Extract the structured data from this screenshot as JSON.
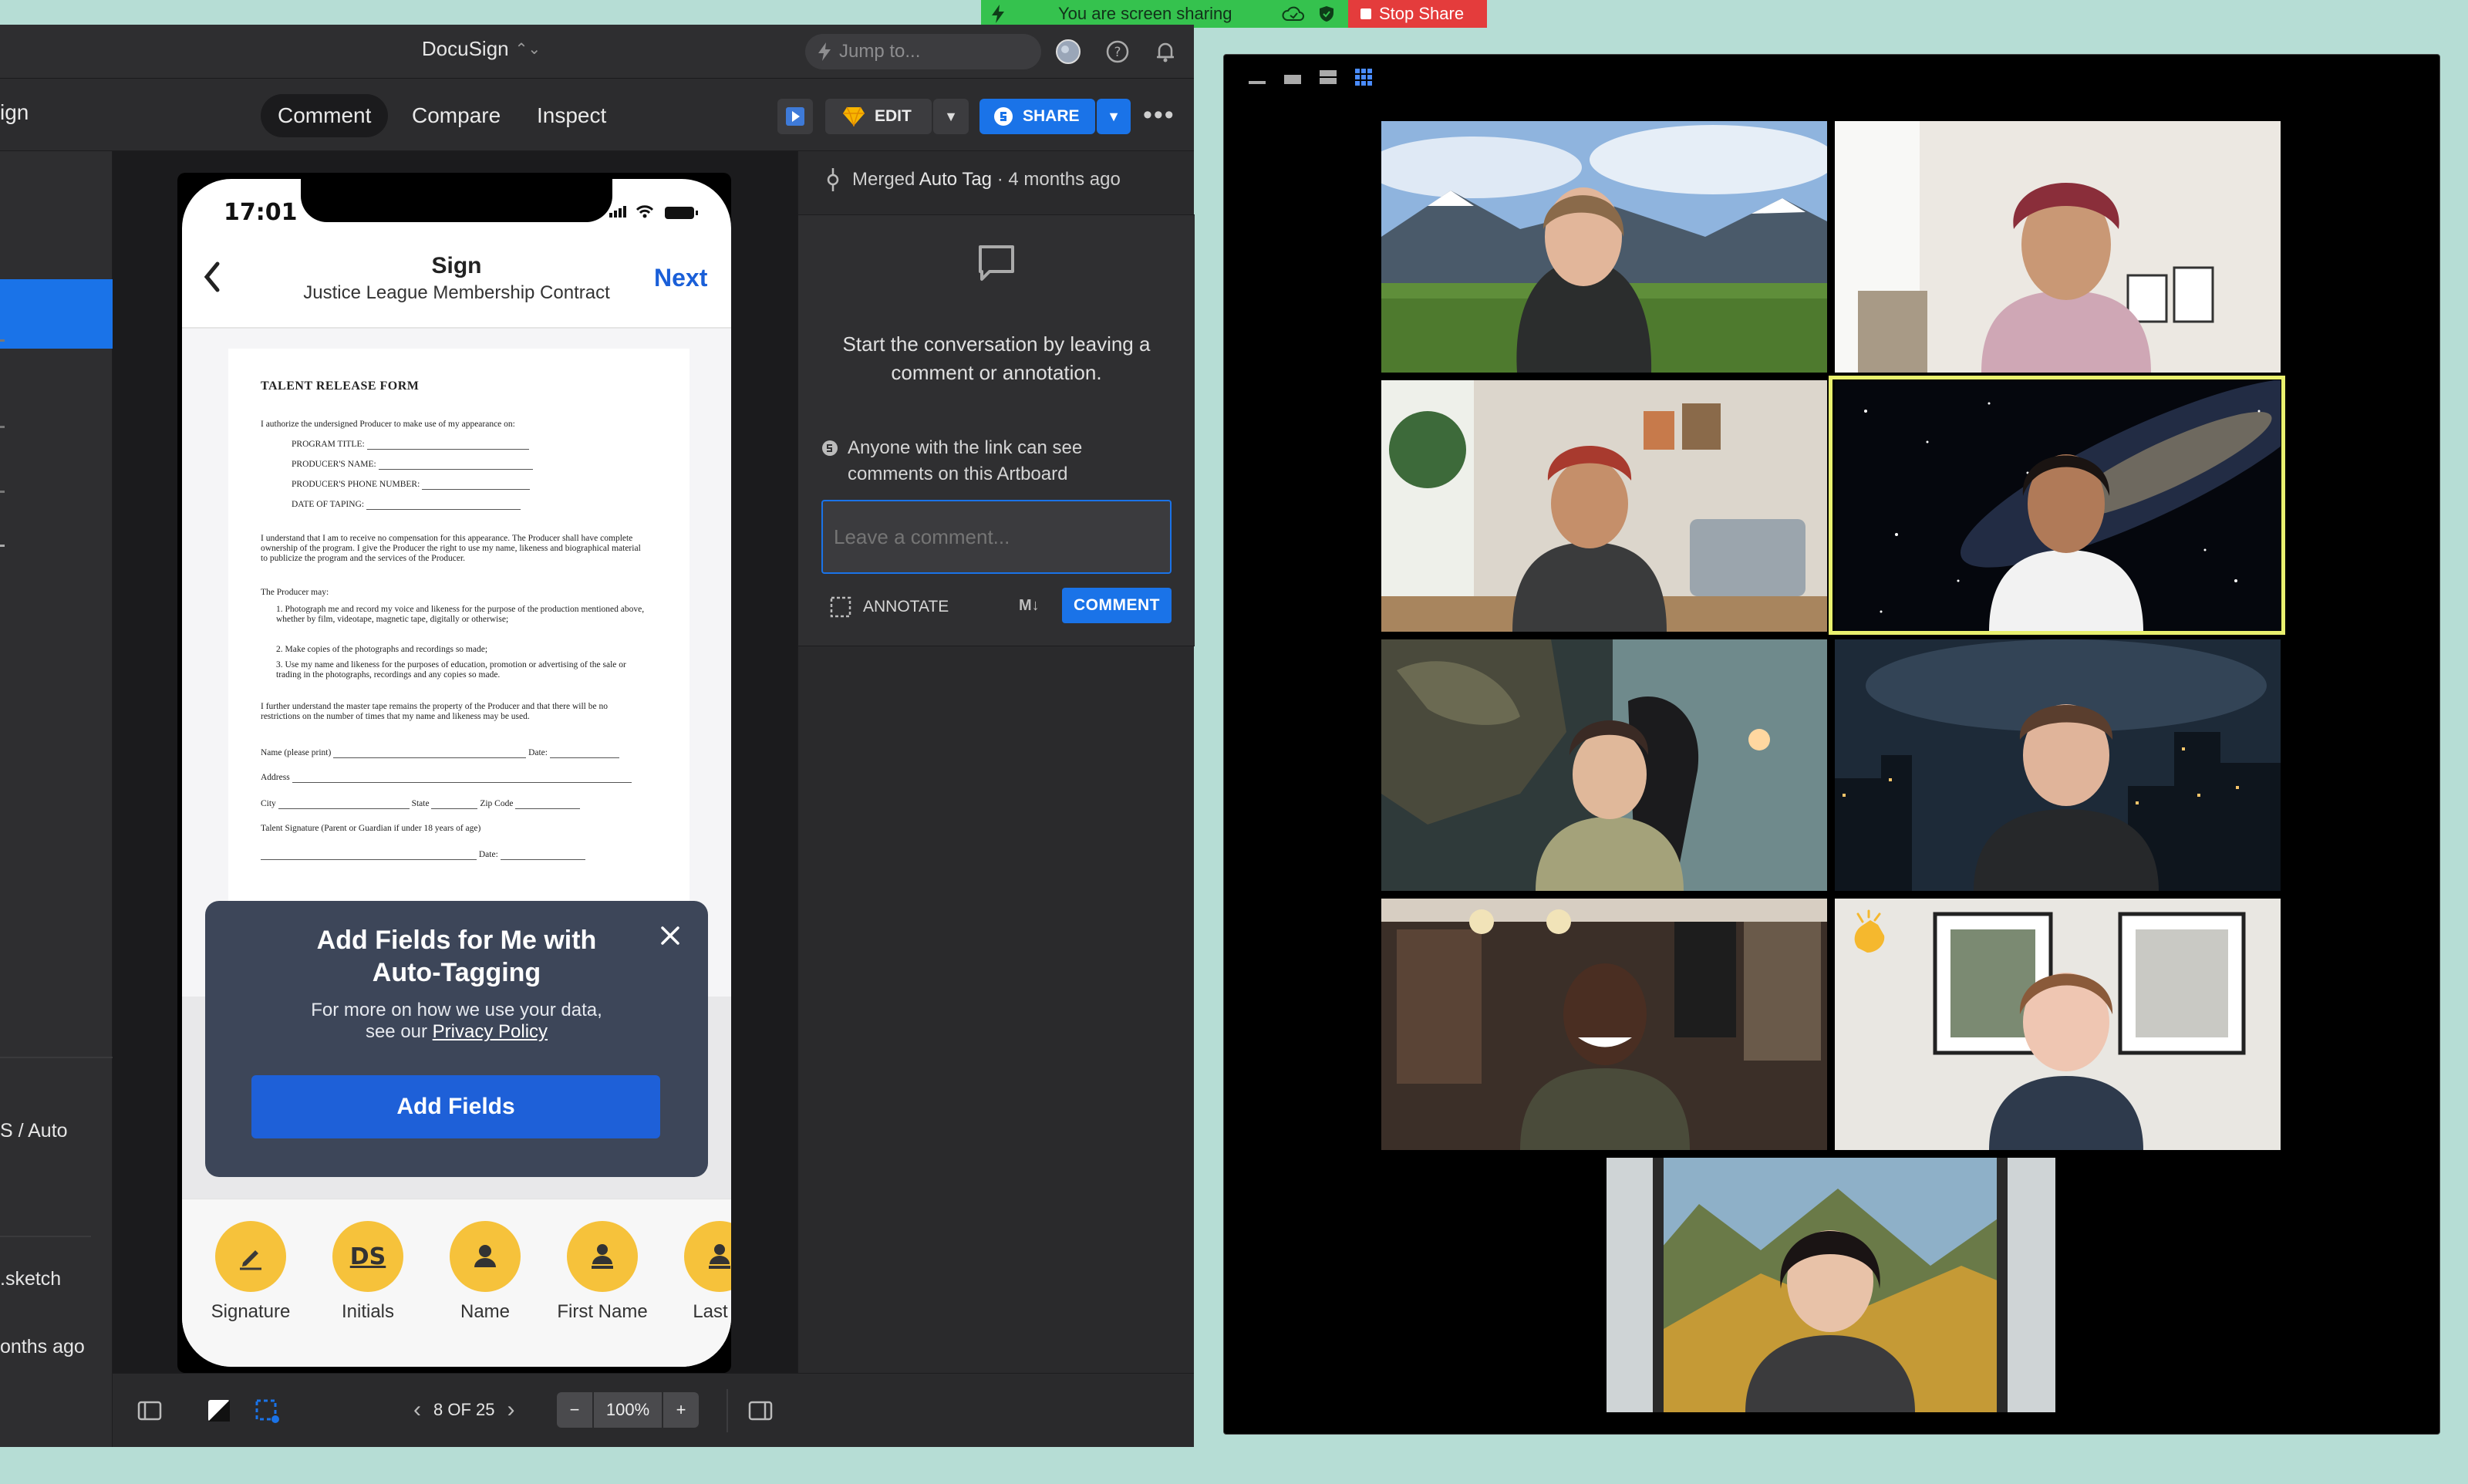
{
  "share_banner": {
    "status": "You are screen sharing",
    "stop_label": "Stop Share"
  },
  "app": {
    "title": "DocuSign",
    "jump_placeholder": "Jump to...",
    "crumb": "ign",
    "tabs": [
      {
        "label": "Comment"
      },
      {
        "label": "Compare"
      },
      {
        "label": "Inspect"
      }
    ],
    "edit_label": "EDIT",
    "share_label": "SHARE",
    "more_label": "•••",
    "sidebar": {
      "frag1": "S / Auto",
      "frag2": ".sketch",
      "frag3": "onths ago"
    }
  },
  "phone": {
    "time": "17:01",
    "header_title": "Sign",
    "header_subtitle": "Justice League Membership Contract",
    "next_label": "Next",
    "document": {
      "heading": "TALENT RELEASE FORM",
      "intro": "I authorize the undersigned Producer to make use of my appearance on:",
      "fields": [
        "PROGRAM TITLE:",
        "PRODUCER'S NAME:",
        "PRODUCER'S PHONE NUMBER:",
        "DATE OF TAPING:"
      ],
      "para1": "I understand that I am to receive no compensation for this appearance. The Producer shall have complete ownership of the program. I give the Producer the right to use my name, likeness and biographical material to publicize the program and the services of the Producer.",
      "may": "The Producer may:",
      "items": [
        "Photograph me and record my voice and likeness for the purpose of the production mentioned above, whether by film, videotape, magnetic tape, digitally or otherwise;",
        "Make copies of the photographs and recordings so made;",
        "Use my name and likeness for the purposes of education, promotion or advertising of the sale or trading in the photographs, recordings and any copies so made."
      ],
      "para2": "I further understand the master tape remains the property of the Producer and that there will be no restrictions on the number of times that my name and likeness may be used.",
      "name_label": "Name (please print)",
      "date_label": "Date:",
      "address_label": "Address",
      "city_label": "City",
      "state_label": "State",
      "zip_label": "Zip Code",
      "sig_label": "Talent Signature (Parent or Guardian if under 18 years of age)"
    },
    "modal": {
      "title_line1": "Add Fields for Me with",
      "title_line2": "Auto-Tagging",
      "body_line1": "For more on how we use your data,",
      "body_line2_prefix": "see our ",
      "privacy_link": "Privacy Policy",
      "button": "Add Fields"
    },
    "fields": [
      {
        "label": "Signature",
        "icon": "pen-icon"
      },
      {
        "label": "Initials",
        "icon": "ds-icon",
        "glyph": "DS"
      },
      {
        "label": "Name",
        "icon": "person-icon"
      },
      {
        "label": "First Name",
        "icon": "person-badge-icon"
      },
      {
        "label": "Last N",
        "icon": "person-badge-icon"
      }
    ]
  },
  "comments": {
    "merged_prefix": "Merged",
    "merged_tag": "Auto Tag",
    "merged_time": " · 4 months ago",
    "empty_line1": "Start the conversation by leaving a",
    "empty_line2": "comment or annotation.",
    "visibility_line1": "Anyone with the link can see",
    "visibility_line2": "comments on this Artboard",
    "input_placeholder": "Leave a comment...",
    "annotate_label": "ANNOTATE",
    "markdown_label": "M↓",
    "comment_button": "COMMENT"
  },
  "bottom_bar": {
    "page": "8 OF 25",
    "zoom_minus": "−",
    "zoom": "100%",
    "zoom_plus": "+"
  },
  "zoom_call": {
    "participants": [
      {
        "background": "mountain-valley"
      },
      {
        "background": "bright-room"
      },
      {
        "background": "living-room"
      },
      {
        "background": "galaxy",
        "active_speaker": true
      },
      {
        "background": "jungle-dinosaur"
      },
      {
        "background": "city-night"
      },
      {
        "background": "cafe"
      },
      {
        "background": "framed-art-wall",
        "reaction": "clapping-hands-icon"
      },
      {
        "background": "alpine-window"
      }
    ]
  },
  "colors": {
    "accent": "#1a73e8",
    "field_yellow": "#f6c23b",
    "share_green": "#35c24e",
    "share_red": "#e43c3c",
    "active_speaker": "#e9f06e"
  }
}
